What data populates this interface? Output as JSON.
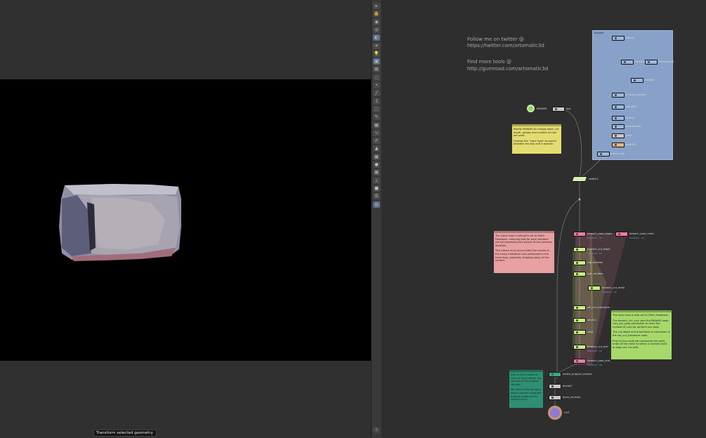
{
  "viewport": {
    "tooltip": "Transform selected geometry."
  },
  "toolbar": {
    "icons": [
      "handle-icon",
      "lock-icon",
      "camera-icon",
      "snapshot-icon",
      "view-icon",
      "light-icon",
      "light-bulb-icon",
      "background-icon",
      "display-icon",
      "ghost-icon",
      "point-icon",
      "wire-icon",
      "pin-icon",
      "select-icon",
      "edit-icon",
      "group-icon",
      "curve-icon",
      "paint-icon",
      "brush-icon",
      "fill-icon",
      "sphere-icon",
      "grid-icon",
      "split-icon",
      "box-icon",
      "stack-icon",
      "globe-icon"
    ],
    "info_icon": "info-icon"
  },
  "network": {
    "credits": {
      "line1": "Follow me on twitter @",
      "line2": "https://twitter.com/artomatic3d",
      "line3": "Find more tools @",
      "line4": "http://gumroad.com/artomatic3d"
    },
    "builder_title": "Builder",
    "colors": {
      "builder": "#8da8d2",
      "loop_green": "#c6f07a",
      "loop_pink": "#f07aa2",
      "note_yellow": "#e4dc6e",
      "note_red": "#e8a0a0",
      "note_green": "#a6d86a",
      "note_teal": "#2f8f74"
    },
    "notes": {
      "yellow": {
        "p1": "Modify PARAMS to change seed, cut depth, passes and number of cuts per pass.",
        "p2": "Change the \"input type\" to switch between the box and a boulder."
      },
      "red": {
        "p1": "The outer loop's method is set to Fetch Feedback, meaning that for each iteration we are processing the output of the previous iteration.",
        "p2": "This allows us to accumulate the results of the many individual cuts performed in the inner loop, gradually chipping away at the surface."
      },
      "green": {
        "p1": "The inner loop is also set to Fetch Feedback.",
        "p2": "The foreach_cut_end uses the PARAMS node cuts_per_pass parameter to drive the number of cuts we perform per pass.",
        "p3": "The cut depth and orientation is calculated in the set_cut_transform node.",
        "p4": "Prior to this node we randomise the point order of the mesh to select a random point to align our cut with."
      },
      "teal": {
        "p1": "Due to the number of cuts we have stored the volume of the original volume.",
        "p2": "We can fix this by using Match volume using the original shape as the second input."
      }
    },
    "nodes": {
      "params": "PARAMS",
      "box": "box",
      "sphere": "sphere",
      "mountain": "mountain",
      "attribnoise": "attribnoise1",
      "merge": "merge1",
      "remesh": "remesh_remesh",
      "smooth": "smooth1",
      "divide": "divide1",
      "polyreduce": "polyreduce1",
      "fuse": "fuse1",
      "polyfill": "polyfill1",
      "match_size": "match_size",
      "switch": "switch1",
      "foreach_pass_begin": "foreach_pass_begin",
      "foreach_pass_meta": "foreach_pass_meta",
      "foreach_cut_begin": "foreach_cut_begin",
      "clip": "clip_boolean",
      "sort": "sort_random",
      "foreach_cut_meta": "foreach_cut_meta",
      "set_cut_transform": "set_cut_transform",
      "xform": "xform1",
      "clip2": "clip2",
      "foreach_cut_end": "foreach_cut_end",
      "foreach_pass_end": "foreach_pass_end",
      "match_volume": "match_original_volume",
      "divide2": "divide2",
      "facet": "facet_normals",
      "out": "OUT",
      "feedback": "Feedback - 00"
    }
  }
}
